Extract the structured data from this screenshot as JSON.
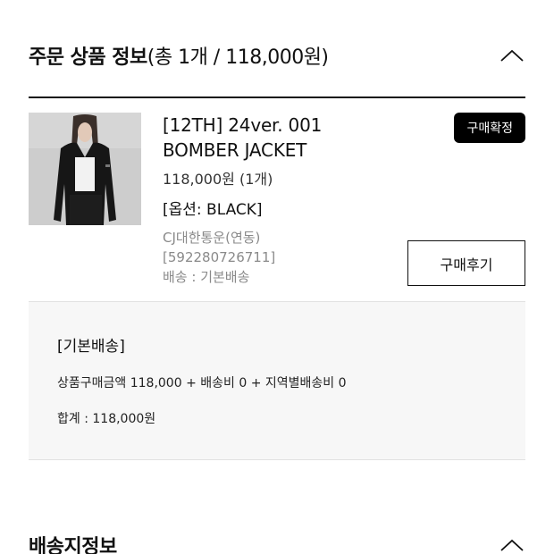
{
  "order_section": {
    "title": "주문 상품 정보",
    "count_summary": "(총 1개 / 118,000원)",
    "toggle_icon": "chevron-up-icon"
  },
  "product": {
    "image_icon": "product-thumbnail",
    "name_line1": "[12TH] 24ver. 001",
    "name_line2": "BOMBER JACKET",
    "price": "118,000원 (1개)",
    "option": "[옵션: BLACK]",
    "carrier": "CJ대한통운(연동)",
    "tracking_number": "[592280726711]",
    "shipping_method": "배송 : 기본배송",
    "status_badge": "구매확정",
    "review_button": "구매후기"
  },
  "summary": {
    "title": "[기본배송]",
    "breakdown": "상품구매금액 118,000 + 배송비 0 + 지역별배송비 0",
    "total": "합계 : 118,000원"
  },
  "shipping_section": {
    "title": "배송지정보",
    "toggle_icon": "chevron-up-icon"
  },
  "colors": {
    "primary": "#111111",
    "badge_bg": "#000000",
    "muted_text": "#8a8a8a",
    "summary_bg": "#f7f7f7"
  }
}
